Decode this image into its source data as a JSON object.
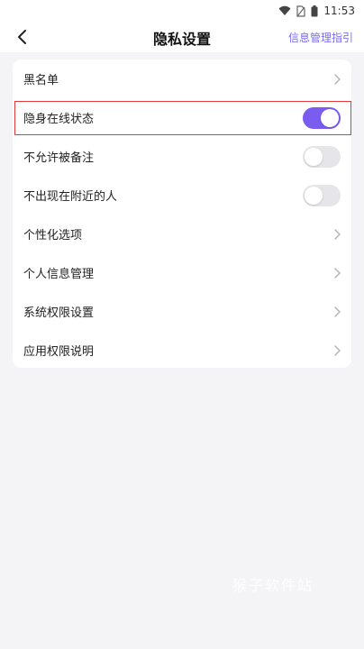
{
  "status_bar": {
    "time": "11:53"
  },
  "nav": {
    "title": "隐私设置",
    "link": "信息管理指引"
  },
  "colors": {
    "accent": "#7b5cf0",
    "highlight": "#e23b3b"
  },
  "settings": [
    {
      "label": "黑名单",
      "control": "chevron"
    },
    {
      "label": "隐身在线状态",
      "control": "toggle",
      "on": true
    },
    {
      "label": "不允许被备注",
      "control": "toggle",
      "on": false
    },
    {
      "label": "不出现在附近的人",
      "control": "toggle",
      "on": false
    },
    {
      "label": "个性化选项",
      "control": "chevron"
    },
    {
      "label": "个人信息管理",
      "control": "chevron"
    },
    {
      "label": "系统权限设置",
      "control": "chevron"
    },
    {
      "label": "应用权限说明",
      "control": "chevron"
    }
  ],
  "watermark": "猴子软件站"
}
